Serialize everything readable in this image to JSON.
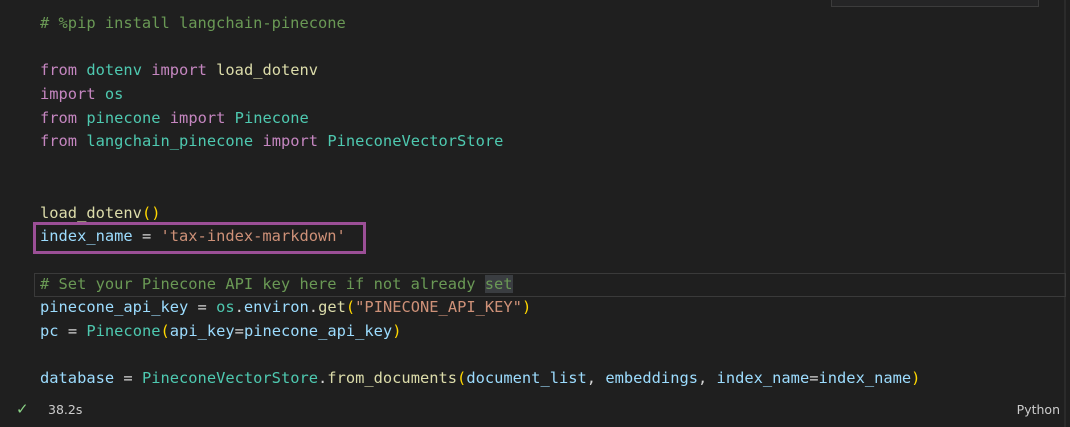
{
  "editor": {
    "lines": [
      [
        {
          "t": "# %pip install langchain-pinecone",
          "c": "comment"
        }
      ],
      [],
      [
        {
          "t": "from",
          "c": "kw"
        },
        {
          "t": " ",
          "c": "op"
        },
        {
          "t": "dotenv",
          "c": "mod"
        },
        {
          "t": " ",
          "c": "op"
        },
        {
          "t": "import",
          "c": "kw"
        },
        {
          "t": " ",
          "c": "op"
        },
        {
          "t": "load_dotenv",
          "c": "fn"
        }
      ],
      [
        {
          "t": "import",
          "c": "kw"
        },
        {
          "t": " ",
          "c": "op"
        },
        {
          "t": "os",
          "c": "mod"
        }
      ],
      [
        {
          "t": "from",
          "c": "kw"
        },
        {
          "t": " ",
          "c": "op"
        },
        {
          "t": "pinecone",
          "c": "mod"
        },
        {
          "t": " ",
          "c": "op"
        },
        {
          "t": "import",
          "c": "kw"
        },
        {
          "t": " ",
          "c": "op"
        },
        {
          "t": "Pinecone",
          "c": "mod"
        }
      ],
      [
        {
          "t": "from",
          "c": "kw"
        },
        {
          "t": " ",
          "c": "op"
        },
        {
          "t": "langchain_pinecone",
          "c": "mod"
        },
        {
          "t": " ",
          "c": "op"
        },
        {
          "t": "import",
          "c": "kw"
        },
        {
          "t": " ",
          "c": "op"
        },
        {
          "t": "PineconeVectorStore",
          "c": "mod"
        }
      ],
      [],
      [],
      [
        {
          "t": "load_dotenv",
          "c": "fn"
        },
        {
          "t": "()",
          "c": "paren"
        }
      ],
      [
        {
          "t": "index_name",
          "c": "var"
        },
        {
          "t": " = ",
          "c": "op"
        },
        {
          "t": "'tax-index-markdown'",
          "c": "str"
        }
      ],
      [],
      [
        {
          "t": "# Set your Pinecone API key here if not already ",
          "c": "comment"
        },
        {
          "t": "set",
          "c": "comment-hl"
        }
      ],
      [
        {
          "t": "pinecone_api_key",
          "c": "var"
        },
        {
          "t": " = ",
          "c": "op"
        },
        {
          "t": "os",
          "c": "mod"
        },
        {
          "t": ".",
          "c": "op"
        },
        {
          "t": "environ",
          "c": "var"
        },
        {
          "t": ".",
          "c": "op"
        },
        {
          "t": "get",
          "c": "fn"
        },
        {
          "t": "(",
          "c": "paren"
        },
        {
          "t": "\"PINECONE_API_KEY\"",
          "c": "str"
        },
        {
          "t": ")",
          "c": "paren"
        }
      ],
      [
        {
          "t": "pc",
          "c": "var"
        },
        {
          "t": " = ",
          "c": "op"
        },
        {
          "t": "Pinecone",
          "c": "mod"
        },
        {
          "t": "(",
          "c": "paren"
        },
        {
          "t": "api_key",
          "c": "var"
        },
        {
          "t": "=",
          "c": "op"
        },
        {
          "t": "pinecone_api_key",
          "c": "var"
        },
        {
          "t": ")",
          "c": "paren"
        }
      ],
      [],
      [
        {
          "t": "database",
          "c": "var"
        },
        {
          "t": " = ",
          "c": "op"
        },
        {
          "t": "PineconeVectorStore",
          "c": "mod"
        },
        {
          "t": ".",
          "c": "op"
        },
        {
          "t": "from_documents",
          "c": "fn"
        },
        {
          "t": "(",
          "c": "paren"
        },
        {
          "t": "document_list",
          "c": "var"
        },
        {
          "t": ", ",
          "c": "op"
        },
        {
          "t": "embeddings",
          "c": "var"
        },
        {
          "t": ", ",
          "c": "op"
        },
        {
          "t": "index_name",
          "c": "var"
        },
        {
          "t": "=",
          "c": "op"
        },
        {
          "t": "index_name",
          "c": "var"
        },
        {
          "t": ")",
          "c": "paren"
        }
      ]
    ]
  },
  "status": {
    "check_icon": "check-icon",
    "exec_time": "38.2s",
    "language": "Python"
  },
  "colors": {
    "background": "#1f1f1f",
    "highlight_border": "#9b4f96",
    "success": "#89d185"
  }
}
